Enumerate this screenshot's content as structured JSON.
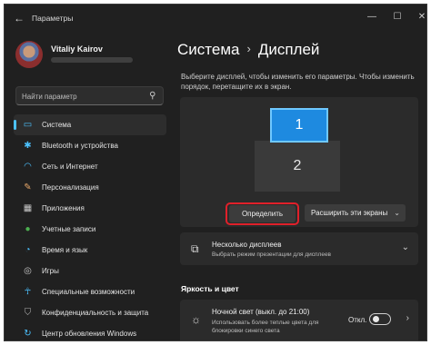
{
  "window": {
    "app_title": "Параметры",
    "controls": {
      "minimize": "—",
      "maximize": "☐",
      "close": "✕"
    }
  },
  "user": {
    "name": "Vitaliy Kairov"
  },
  "search": {
    "placeholder": "Найти параметр",
    "icon": "search-icon"
  },
  "sidebar": {
    "items": [
      {
        "label": "Система",
        "icon": "monitor-icon",
        "color": "#4cc2ff",
        "active": true
      },
      {
        "label": "Bluetooth и устройства",
        "icon": "bluetooth-icon",
        "color": "#4cc2ff"
      },
      {
        "label": "Сеть и Интернет",
        "icon": "wifi-icon",
        "color": "#4cc2ff"
      },
      {
        "label": "Персонализация",
        "icon": "brush-icon",
        "color": "#e8a86a"
      },
      {
        "label": "Приложения",
        "icon": "apps-icon",
        "color": "#c8c8c8"
      },
      {
        "label": "Учетные записи",
        "icon": "account-icon",
        "color": "#4caf50"
      },
      {
        "label": "Время и язык",
        "icon": "globe-clock-icon",
        "color": "#4cc2ff"
      },
      {
        "label": "Игры",
        "icon": "gamepad-icon",
        "color": "#c8c8c8"
      },
      {
        "label": "Специальные возможности",
        "icon": "accessibility-icon",
        "color": "#4cc2ff"
      },
      {
        "label": "Конфиденциальность и защита",
        "icon": "shield-icon",
        "color": "#b0b0b0"
      },
      {
        "label": "Центр обновления Windows",
        "icon": "update-icon",
        "color": "#4cc2ff"
      }
    ]
  },
  "header": {
    "crumb_parent": "Система",
    "crumb_separator": "›",
    "crumb_current": "Дисплей"
  },
  "display": {
    "hint": "Выберите дисплей, чтобы изменить его параметры. Чтобы изменить порядок, перетащите их в экран.",
    "monitors": [
      {
        "label": "1",
        "selected": true
      },
      {
        "label": "2",
        "selected": false
      }
    ],
    "identify_label": "Определить",
    "extend_label": "Расширить эти экраны"
  },
  "multiple_displays": {
    "title": "Несколько дисплеев",
    "subtitle": "Выбрать режим презентации для дисплеев"
  },
  "brightness_section": {
    "title": "Яркость и цвет"
  },
  "night_light": {
    "title": "Ночной свет (выкл. до 21:00)",
    "subtitle": "Использовать более теплые цвета для блокировки синего света",
    "toggle_label": "Откл.",
    "toggle_on": false
  },
  "colors": {
    "accent": "#4cc2ff",
    "highlight_outline": "#e0202a",
    "background": "#202020",
    "card": "#2b2b2b"
  }
}
